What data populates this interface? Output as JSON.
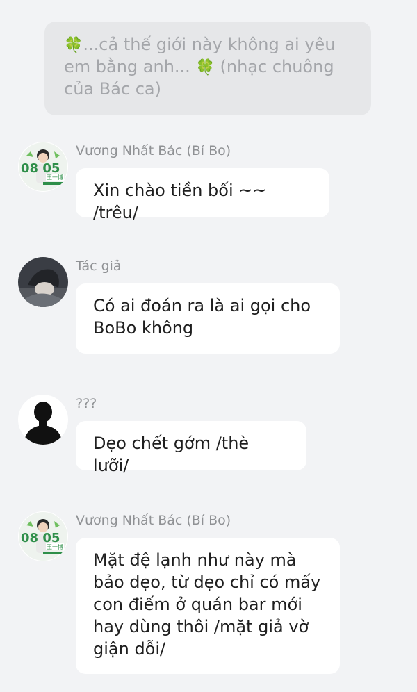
{
  "system_note": {
    "icon": "clover-icon",
    "text_part1": "...cả thế giới này không ai yêu em bằng anh...",
    "text_part2": "(nhạc chuông của Bác ca)"
  },
  "messages": [
    {
      "sender": "Vương Nhất Bác (Bí Bo)",
      "avatar": "avatar-wang-yibo",
      "text": "Xin chào tiền bối ~~ /trêu/"
    },
    {
      "sender": "Tác giả",
      "avatar": "avatar-author",
      "text": "Có ai đoán ra là ai gọi cho BoBo không"
    },
    {
      "sender": "???",
      "avatar": "avatar-silhouette",
      "text": "Dẹo chết gớm /thè lưỡi/"
    },
    {
      "sender": "Vương Nhất Bác (Bí Bo)",
      "avatar": "avatar-wang-yibo",
      "text": "Mặt đệ lạnh như này mà bảo dẹo, từ dẹo chỉ có mấy con điếm ở quán bar mới hay dùng thôi /mặt giả vờ giận dỗi/"
    }
  ],
  "avatar_wang_yibo": {
    "numbers": "08 05",
    "caption": "王一博"
  },
  "colors": {
    "background": "#f2f3f5",
    "system_bubble": "#e6e7e9",
    "message_bubble": "#ffffff",
    "accent_green": "#2f8f4a"
  }
}
